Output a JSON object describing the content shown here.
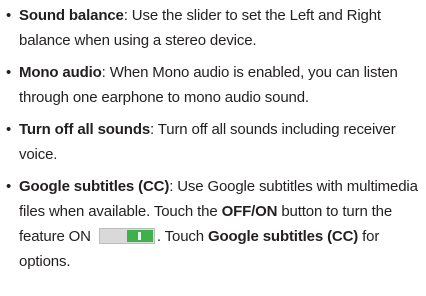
{
  "bullet": "•",
  "items": [
    {
      "term": "Sound balance",
      "text": ": Use the slider to set the Left and Right balance when using a stereo device."
    },
    {
      "term": "Mono audio",
      "text": ": When Mono audio is enabled, you can listen through one earphone to mono audio sound."
    },
    {
      "term": "Turn off all sounds",
      "text": ": Turn off all sounds including receiver voice."
    },
    {
      "term": "Google subtitles (CC)",
      "text_1": ": Use Google subtitles with multimedia files when available. Touch the ",
      "bold_1": "OFF/ON",
      "text_2": " button to turn the feature ON ",
      "text_3": ". Touch ",
      "bold_2": "Google subtitles (CC)",
      "text_4": " for options."
    }
  ],
  "toggle_state": "on",
  "colors": {
    "text": "#231f20",
    "toggle_on": "#3fb14a",
    "toggle_track": "#d9d9d9"
  }
}
